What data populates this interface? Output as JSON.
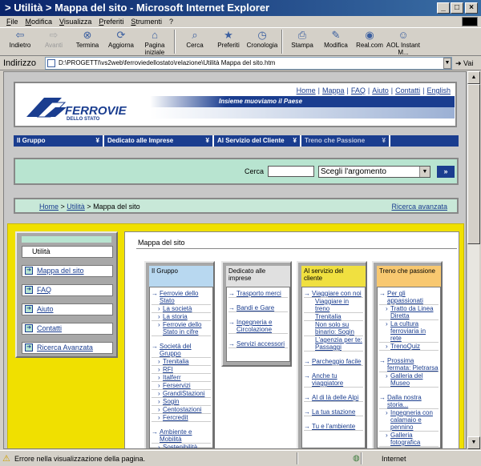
{
  "window": {
    "title": "> Utilità > Mappa del sito - Microsoft Internet Explorer"
  },
  "menu": [
    "File",
    "Modifica",
    "Visualizza",
    "Preferiti",
    "Strumenti",
    "?"
  ],
  "toolbar": [
    {
      "label": "Indietro",
      "icon": "back-arrow-icon",
      "glyph": "⇦",
      "enabled": true
    },
    {
      "label": "Avanti",
      "icon": "forward-arrow-icon",
      "glyph": "⇨",
      "enabled": false
    },
    {
      "label": "Termina",
      "icon": "stop-icon",
      "glyph": "⊗",
      "enabled": true
    },
    {
      "label": "Aggiorna",
      "icon": "refresh-icon",
      "glyph": "⟳",
      "enabled": true
    },
    {
      "label": "Pagina iniziale",
      "icon": "home-icon",
      "glyph": "⌂",
      "enabled": true
    },
    {
      "label": "Cerca",
      "icon": "search-icon",
      "glyph": "⌕",
      "enabled": true
    },
    {
      "label": "Preferiti",
      "icon": "favorites-icon",
      "glyph": "★",
      "enabled": true
    },
    {
      "label": "Cronologia",
      "icon": "history-icon",
      "glyph": "◷",
      "enabled": true
    },
    {
      "label": "Stampa",
      "icon": "print-icon",
      "glyph": "⎙",
      "enabled": true
    },
    {
      "label": "Modifica",
      "icon": "edit-icon",
      "glyph": "✎",
      "enabled": true
    },
    {
      "label": "Real.com",
      "icon": "realcom-icon",
      "glyph": "◉",
      "enabled": true
    },
    {
      "label": "AOL Instant M...",
      "icon": "aol-messenger-icon",
      "glyph": "☺",
      "enabled": true
    }
  ],
  "address": {
    "label": "Indirizzo",
    "value": "D:\\PROGETTI\\vs2web\\ferroviedellostato\\relazione\\Utilità  Mappa del sito.htm",
    "go": "Vai"
  },
  "header": {
    "logo_text": "FERROVIE",
    "logo_sub": "DELLO STATO",
    "top_links": [
      "Home",
      "Mappa",
      "FAQ",
      "Aiuto",
      "Contatti",
      "English"
    ],
    "slogan": "Insieme muoviamo il Paese"
  },
  "nav": [
    "Il Gruppo",
    "Dedicato alle Imprese",
    "Al Servizio del Cliente",
    "Treno che Passione"
  ],
  "search": {
    "label": "Cerca",
    "select": "Scegli l'argomento",
    "button": "»"
  },
  "breadcrumb": {
    "home": "Home",
    "utilita": "Utilità",
    "current": "Mappa del sito",
    "advanced": "Ricerca avanzata"
  },
  "left_menu": {
    "title": "Utilità",
    "items": [
      "Mappa del sito",
      "FAQ",
      "Aiuto",
      "Contatti",
      "Ricerca Avanzata"
    ]
  },
  "content": {
    "title": "Mappa del sito",
    "columns": [
      {
        "title": "Il Gruppo",
        "color": "#b8d8f0",
        "links": [
          {
            "t": "Ferrovie dello Stato",
            "k": "top"
          },
          {
            "t": "La società",
            "k": "sub"
          },
          {
            "t": "La storia",
            "k": "sub"
          },
          {
            "t": "Ferrovie dello Stato in cifre",
            "k": "sub"
          },
          {
            "t": "Società del Gruppo",
            "k": "top"
          },
          {
            "t": "Trenitalia",
            "k": "sub"
          },
          {
            "t": "RFI",
            "k": "sub"
          },
          {
            "t": "Italferr",
            "k": "sub"
          },
          {
            "t": "Ferservizi",
            "k": "sub"
          },
          {
            "t": "GrandiStazioni",
            "k": "sub"
          },
          {
            "t": "Sogin",
            "k": "sub"
          },
          {
            "t": "Centostazioni",
            "k": "sub"
          },
          {
            "t": "Fercredit",
            "k": "sub"
          },
          {
            "t": "Ambiente e Mobilità",
            "k": "top"
          },
          {
            "t": "Sostenibilità Ambientale",
            "k": "sub"
          }
        ]
      },
      {
        "title": "Dedicato alle imprese",
        "color": "#e0e0e0",
        "links": [
          {
            "t": "Trasporto merci",
            "k": "top"
          },
          {
            "t": "Bandi e Gare",
            "k": "top"
          },
          {
            "t": "Ingegneria e Circolazione",
            "k": "top"
          },
          {
            "t": "Servizi accessori",
            "k": "top"
          }
        ]
      },
      {
        "title": "Al servizio del cliente",
        "color": "#f0e040",
        "links": [
          {
            "t": "Viaggiare con noi",
            "k": "top"
          },
          {
            "t": "Viaggiare in treno",
            "k": "cont"
          },
          {
            "t": "Trenitalia",
            "k": "cont"
          },
          {
            "t": "Non solo su binario: Sogin",
            "k": "cont"
          },
          {
            "t": "L'agenzia per te: Passaggi",
            "k": "cont"
          },
          {
            "t": "Parcheggio facile",
            "k": "top"
          },
          {
            "t": "Anche tu viaggiatore",
            "k": "top"
          },
          {
            "t": "Al di là delle Alpi",
            "k": "top"
          },
          {
            "t": "La tua stazione",
            "k": "top"
          },
          {
            "t": "Tu e l'ambiente",
            "k": "top"
          }
        ]
      },
      {
        "title": "Treno che passione",
        "color": "#f8c870",
        "links": [
          {
            "t": "Per gli appassionati",
            "k": "top"
          },
          {
            "t": "Tratto da Linea Diretta",
            "k": "sub"
          },
          {
            "t": "La cultura ferroviaria in rete",
            "k": "sub"
          },
          {
            "t": "TrenoQuiz",
            "k": "sub"
          },
          {
            "t": "Prossima fermata: Pietrarsa",
            "k": "top"
          },
          {
            "t": "Galleria del Museo",
            "k": "sub"
          },
          {
            "t": "Dalla nostra storia...",
            "k": "top"
          },
          {
            "t": "Ingegneria con calamaio e pennino",
            "k": "sub"
          },
          {
            "t": "Galleria fotografica",
            "k": "sub"
          }
        ]
      }
    ]
  },
  "status": {
    "text": "Errore nella visualizzazione della pagina.",
    "zone": "Internet"
  }
}
